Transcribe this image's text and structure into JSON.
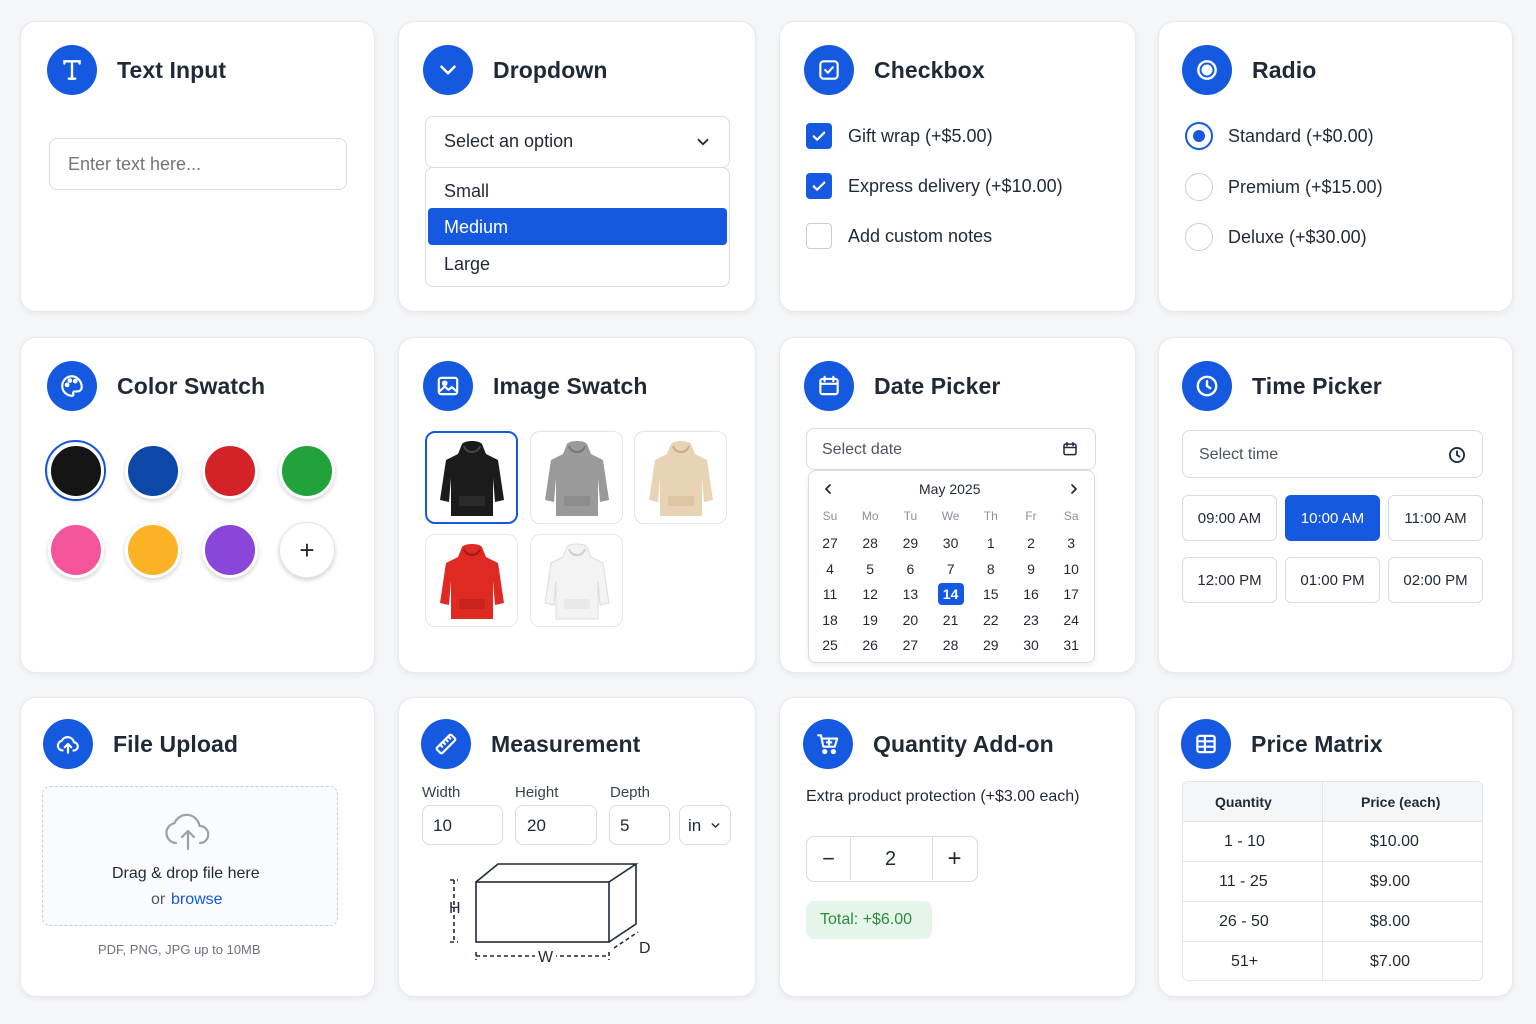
{
  "cards": {
    "text_input": {
      "title": "Text Input",
      "placeholder": "Enter text here..."
    },
    "dropdown": {
      "title": "Dropdown",
      "select_placeholder": "Select an option",
      "options": [
        "Small",
        "Medium",
        "Large"
      ],
      "highlighted_option": "Medium"
    },
    "checkbox": {
      "title": "Checkbox",
      "items": [
        {
          "label": "Gift wrap (+$5.00)",
          "checked": true
        },
        {
          "label": "Express delivery (+$10.00)",
          "checked": true
        },
        {
          "label": "Add custom notes",
          "checked": false
        }
      ]
    },
    "radio": {
      "title": "Radio",
      "items": [
        {
          "label": "Standard (+$0.00)",
          "selected": true
        },
        {
          "label": "Premium (+$15.00)",
          "selected": false
        },
        {
          "label": "Deluxe (+$30.00)",
          "selected": false
        }
      ]
    },
    "color_swatch": {
      "title": "Color Swatch",
      "colors": [
        "#151515",
        "#0d47a8",
        "#d32228",
        "#22a23a",
        "#f4559a",
        "#fbb224",
        "#8a46d8"
      ],
      "selected_color": "#151515",
      "add_label": "+"
    },
    "image_swatch": {
      "title": "Image Swatch",
      "items": [
        {
          "name": "black-hoodie",
          "color": "#1b1b1b"
        },
        {
          "name": "gray-hoodie",
          "color": "#9a9a9a"
        },
        {
          "name": "beige-hoodie",
          "color": "#e8d3b5"
        },
        {
          "name": "red-hoodie",
          "color": "#df2a23"
        },
        {
          "name": "white-hoodie",
          "color": "#f3f3f3"
        }
      ],
      "selected": "black-hoodie"
    },
    "date_picker": {
      "title": "Date Picker",
      "placeholder": "Select date",
      "month_label": "May 2025",
      "weekdays": [
        "Su",
        "Mo",
        "Tu",
        "We",
        "Th",
        "Fr",
        "Sa"
      ],
      "weeks": [
        [
          "27",
          "28",
          "29",
          "30",
          "1",
          "2",
          "3"
        ],
        [
          "4",
          "5",
          "6",
          "7",
          "8",
          "9",
          "10"
        ],
        [
          "11",
          "12",
          "13",
          "14",
          "15",
          "16",
          "17"
        ],
        [
          "18",
          "19",
          "20",
          "21",
          "22",
          "23",
          "24"
        ],
        [
          "25",
          "26",
          "27",
          "28",
          "29",
          "30",
          "31"
        ]
      ],
      "selected_day": "14"
    },
    "time_picker": {
      "title": "Time Picker",
      "placeholder": "Select time",
      "slots": [
        "09:00 AM",
        "10:00 AM",
        "11:00 AM",
        "12:00 PM",
        "01:00 PM",
        "02:00 PM"
      ],
      "selected_slot": "10:00 AM"
    },
    "file_upload": {
      "title": "File Upload",
      "drop_text": "Drag & drop file here",
      "or_text": "or",
      "browse_text": "browse",
      "hint": "PDF, PNG, JPG up to 10MB"
    },
    "measurement": {
      "title": "Measurement",
      "fields": [
        {
          "label": "Width",
          "value": "10"
        },
        {
          "label": "Height",
          "value": "20"
        },
        {
          "label": "Depth",
          "value": "5"
        }
      ],
      "unit": "in",
      "diagram_labels": {
        "h": "H",
        "w": "W",
        "d": "D"
      }
    },
    "quantity_addon": {
      "title": "Quantity Add-on",
      "description": "Extra product protection (+$3.00 each)",
      "minus": "−",
      "plus": "+",
      "quantity": "2",
      "total": "Total: +$6.00"
    },
    "price_matrix": {
      "title": "Price Matrix",
      "headers": [
        "Quantity",
        "Price (each)"
      ],
      "rows": [
        [
          "1 - 10",
          "$10.00"
        ],
        [
          "11 - 25",
          "$9.00"
        ],
        [
          "26 - 50",
          "$8.00"
        ],
        [
          "51+",
          "$7.00"
        ]
      ]
    }
  },
  "accent_color": "#1459e0"
}
